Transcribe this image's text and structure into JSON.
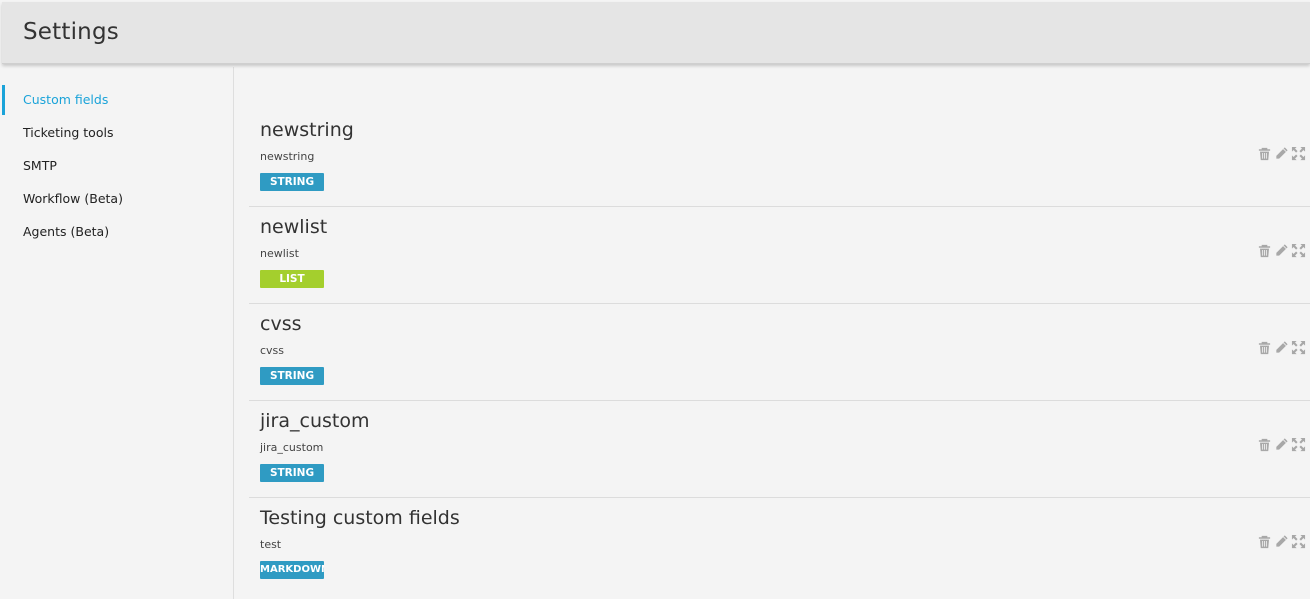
{
  "header": {
    "title": "Settings"
  },
  "sidebar": {
    "items": [
      {
        "label": "Custom fields"
      },
      {
        "label": "Ticketing tools"
      },
      {
        "label": "SMTP"
      },
      {
        "label": "Workflow (Beta)"
      },
      {
        "label": "Agents (Beta)"
      }
    ]
  },
  "colors": {
    "accent": "#1aa3d9",
    "badge_string": "#2f9bc3",
    "badge_list": "#a4cf2d",
    "icon": "#a8a8a8"
  },
  "icons": {
    "delete": "trash-icon",
    "edit": "pencil-icon",
    "move": "move-arrows-icon"
  },
  "fields": [
    {
      "title": "newstring",
      "key": "newstring",
      "type": "STRING"
    },
    {
      "title": "newlist",
      "key": "newlist",
      "type": "LIST"
    },
    {
      "title": "cvss",
      "key": "cvss",
      "type": "STRING"
    },
    {
      "title": "jira_custom",
      "key": "jira_custom",
      "type": "STRING"
    },
    {
      "title": "Testing custom fields",
      "key": "test",
      "type": "MARKDOWN"
    }
  ]
}
